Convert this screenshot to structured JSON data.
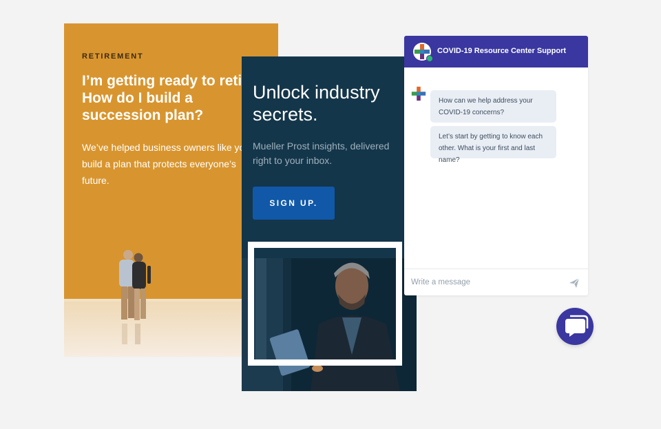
{
  "retirement_card": {
    "eyebrow": "RETIREMENT",
    "headline": "I’m getting ready to retire.\nHow do I build a\nsuccession plan?",
    "body": "We’ve helped business owners like you\nbuild a plan that protects everyone’s\nfuture."
  },
  "newsletter_card": {
    "headline": "Unlock industry\nsecrets.",
    "subtext": "Mueller Prost insights, delivered right to your inbox.",
    "button_label": "SIGN UP."
  },
  "chat_widget": {
    "title": "COVID-19 Resource Center Support",
    "messages": [
      "How can we help address your COVID-19 concerns?",
      "Let’s start by getting to know each other. What is your first and last name?"
    ],
    "input_placeholder": "Write a message"
  },
  "colors": {
    "retirement_bg": "#d8952f",
    "newsletter_bg": "#14364a",
    "button_blue": "#1158a8",
    "chat_header": "#3a37a0",
    "bubble_bg": "#e9eef5"
  },
  "icons": {
    "logo": "cross-logo-icon",
    "send": "send-icon",
    "launcher": "chat-bubble-icon"
  }
}
